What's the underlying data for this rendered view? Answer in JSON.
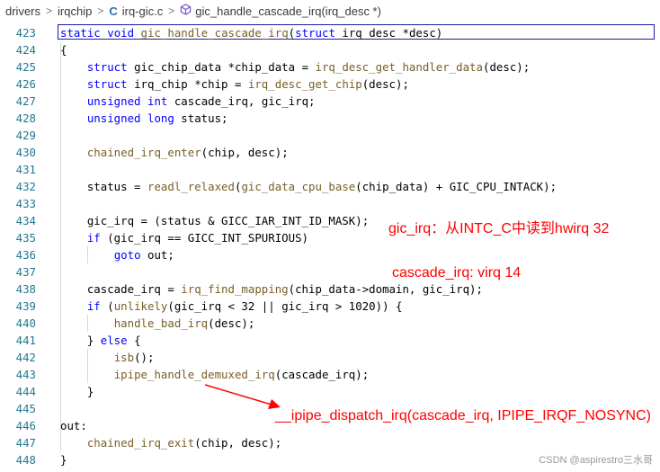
{
  "breadcrumb": {
    "items": [
      "drivers",
      "irqchip",
      "irq-gic.c",
      "gic_handle_cascade_irq(irq_desc *)"
    ],
    "file_icon": "C",
    "separator": ">"
  },
  "code_lines": [
    {
      "n": "423",
      "html": "<span class='kw'>static</span> <span class='kw'>void</span> <span class='fn'>gic_handle_cascade_irq</span>(<span class='kw'>struct</span> irq_desc *desc)"
    },
    {
      "n": "424",
      "html": "{"
    },
    {
      "n": "425",
      "html": "    <span class='kw'>struct</span> gic_chip_data *chip_data = <span class='fn'>irq_desc_get_handler_data</span>(desc);"
    },
    {
      "n": "426",
      "html": "    <span class='kw'>struct</span> irq_chip *chip = <span class='fn'>irq_desc_get_chip</span>(desc);"
    },
    {
      "n": "427",
      "html": "    <span class='kw'>unsigned</span> <span class='kw'>int</span> cascade_irq, gic_irq;"
    },
    {
      "n": "428",
      "html": "    <span class='kw'>unsigned</span> <span class='kw'>long</span> status;"
    },
    {
      "n": "429",
      "html": ""
    },
    {
      "n": "430",
      "html": "    <span class='fn'>chained_irq_enter</span>(chip, desc);"
    },
    {
      "n": "431",
      "html": ""
    },
    {
      "n": "432",
      "html": "    status = <span class='fn'>readl_relaxed</span>(<span class='fn'>gic_data_cpu_base</span>(chip_data) + GIC_CPU_INTACK);"
    },
    {
      "n": "433",
      "html": ""
    },
    {
      "n": "434",
      "html": "    gic_irq = (status &amp; GICC_IAR_INT_ID_MASK);"
    },
    {
      "n": "435",
      "html": "    <span class='kw'>if</span> (gic_irq == GICC_INT_SPURIOUS)"
    },
    {
      "n": "436",
      "html": "        <span class='kw'>goto</span> out;"
    },
    {
      "n": "437",
      "html": ""
    },
    {
      "n": "438",
      "html": "    cascade_irq = <span class='fn'>irq_find_mapping</span>(chip_data-&gt;domain, gic_irq);"
    },
    {
      "n": "439",
      "html": "    <span class='kw'>if</span> (<span class='fn'>unlikely</span>(gic_irq &lt; 32 || gic_irq &gt; 1020)) {"
    },
    {
      "n": "440",
      "html": "        <span class='fn'>handle_bad_irq</span>(desc);"
    },
    {
      "n": "441",
      "html": "    } <span class='kw'>else</span> {"
    },
    {
      "n": "442",
      "html": "        <span class='fn'>isb</span>();"
    },
    {
      "n": "443",
      "html": "        <span class='fn'>ipipe_handle_demuxed_irq</span>(cascade_irq);"
    },
    {
      "n": "444",
      "html": "    }"
    },
    {
      "n": "445",
      "html": ""
    },
    {
      "n": "446",
      "html": "out:"
    },
    {
      "n": "447",
      "html": "    <span class='fn'>chained_irq_exit</span>(chip, desc);"
    },
    {
      "n": "448",
      "html": "}"
    }
  ],
  "annotations": {
    "gic_irq_note": "gic_irq：从INTC_C中读到hwirq 32",
    "cascade_note": "cascade_irq: virq 14",
    "dispatch_note": "__ipipe_dispatch_irq(cascade_irq, IPIPE_IRQF_NOSYNC)"
  },
  "watermark": "CSDN @aspirestro三水哥",
  "colors": {
    "keyword": "#0000ff",
    "function": "#795e26",
    "line_number": "#237893",
    "annotation": "#ff0000"
  }
}
